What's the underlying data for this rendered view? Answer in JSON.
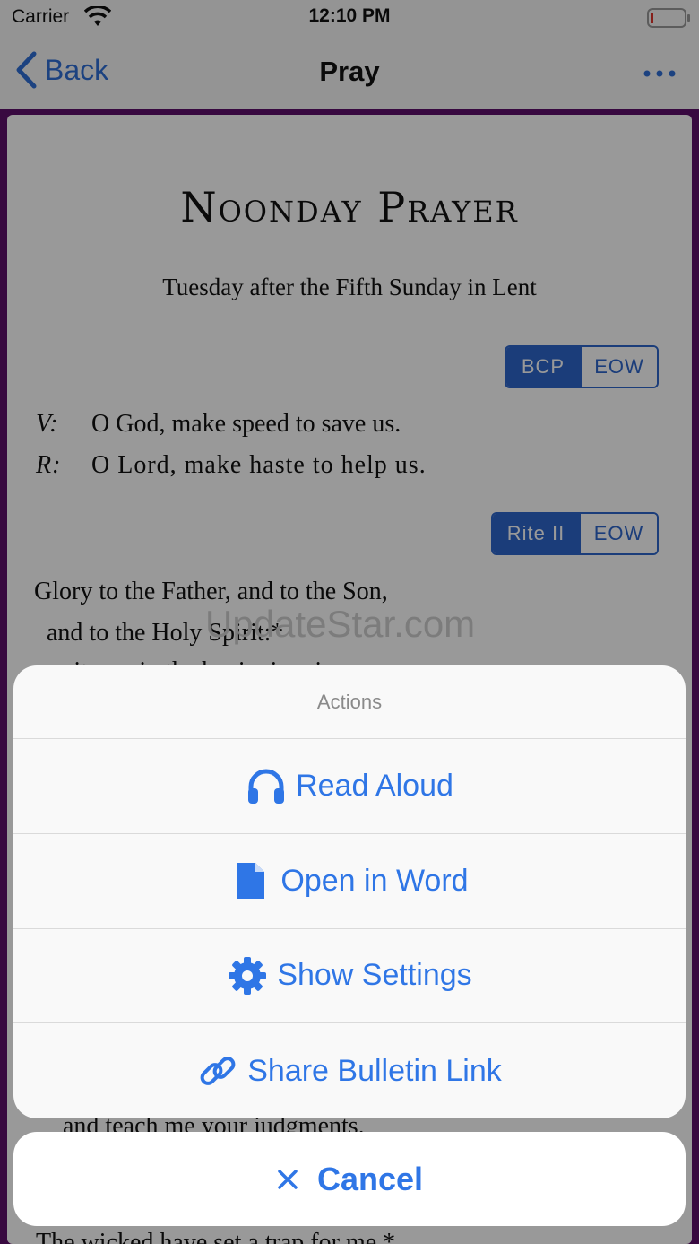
{
  "status_bar": {
    "carrier": "Carrier",
    "time": "12:10 PM"
  },
  "nav": {
    "back_label": "Back",
    "title": "Pray"
  },
  "document": {
    "title": "Noonday Prayer",
    "subtitle": "Tuesday after the Fifth Sunday in Lent",
    "toggle1": {
      "selected": "BCP",
      "other": "EOW"
    },
    "toggle2": {
      "selected": "Rite II",
      "other": "EOW"
    },
    "versicles": [
      {
        "marker": "V:",
        "text": "O God, make speed to save us."
      },
      {
        "marker": "R:",
        "text": "O Lord, make haste to help us."
      }
    ],
    "gloria_line1": "Glory to the Father, and to the Son,",
    "gloria_line2": "and to the Holy Spirit:*",
    "partial_line_behind_sheet": "as it was in the beginning, is now,",
    "partial_line_lower": "and teach me your judgments.",
    "partial_line_bottom": "The wicked have set a trap for me,*"
  },
  "watermark": "UpdateStar.com",
  "action_sheet": {
    "header": "Actions",
    "items": [
      {
        "label": "Read Aloud",
        "icon": "headphones-icon"
      },
      {
        "label": "Open in Word",
        "icon": "file-icon"
      },
      {
        "label": "Show Settings",
        "icon": "gear-icon"
      },
      {
        "label": "Share Bulletin Link",
        "icon": "link-icon"
      }
    ],
    "cancel_label": "Cancel"
  },
  "colors": {
    "accent": "#2f76e6",
    "frame": "#5e0f6b",
    "segment": "#2d66cc"
  }
}
